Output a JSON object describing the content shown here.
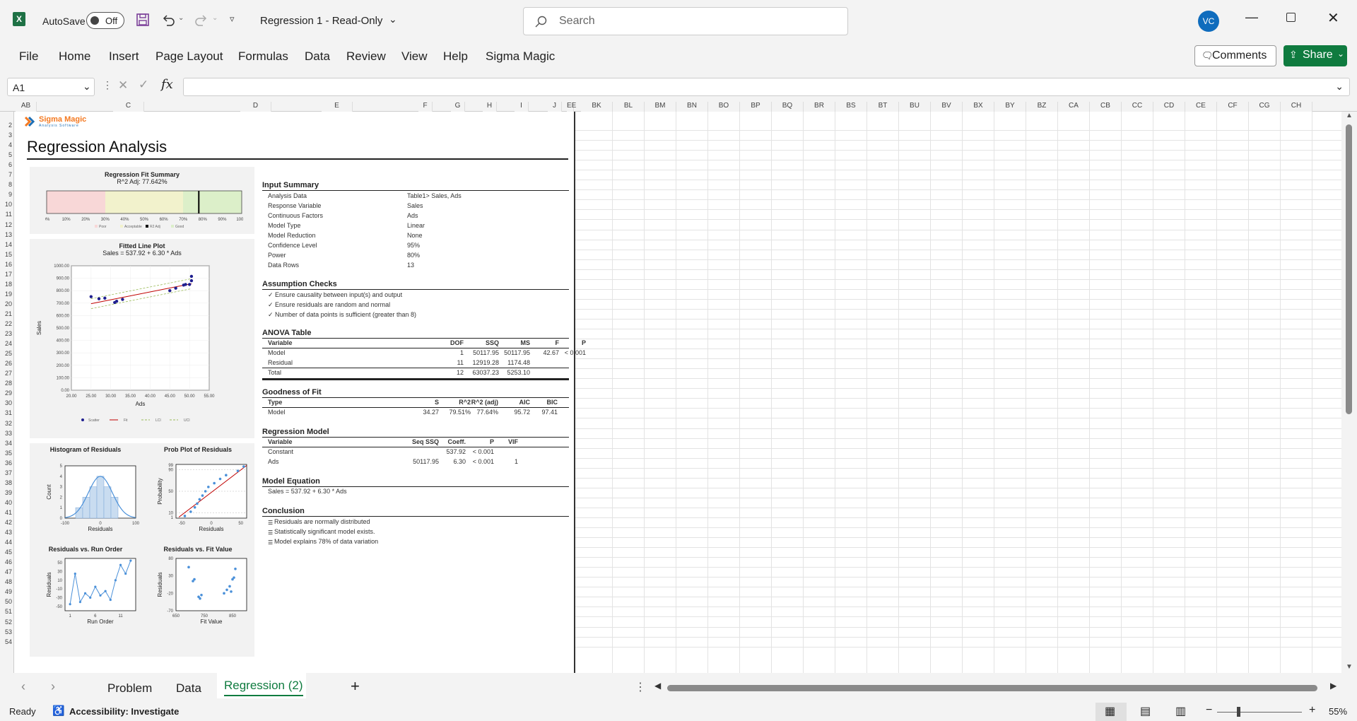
{
  "titlebar": {
    "autosave": "AutoSave",
    "toggle": "Off",
    "doc_title": "Regression 1  -  Read-Only",
    "search_placeholder": "Search",
    "avatar": "VC"
  },
  "ribbon": {
    "tabs": [
      "File",
      "Home",
      "Insert",
      "Page Layout",
      "Formulas",
      "Data",
      "Review",
      "View",
      "Help",
      "Sigma Magic"
    ],
    "comments": "Comments",
    "share": "Share"
  },
  "formula_bar": {
    "name_box": "A1",
    "fx": "fx",
    "value": ""
  },
  "columns_left": [
    "AB",
    "C",
    "D",
    "E",
    "F",
    "G",
    "H",
    "I",
    "J",
    "EE"
  ],
  "columns_right": [
    "BK",
    "BL",
    "BM",
    "BN",
    "BO",
    "BP",
    "BQ",
    "BR",
    "BS",
    "BT",
    "BU",
    "BV",
    "BX",
    "BY",
    "BZ",
    "CA",
    "CB",
    "CC",
    "CD",
    "CE",
    "CF",
    "CG",
    "CH"
  ],
  "rows": [
    "2",
    "3",
    "4",
    "5",
    "6",
    "7",
    "8",
    "9",
    "10",
    "11",
    "12",
    "13",
    "14",
    "15",
    "16",
    "17",
    "18",
    "19",
    "20",
    "21",
    "22",
    "23",
    "24",
    "25",
    "26",
    "27",
    "28",
    "29",
    "30",
    "31",
    "32",
    "33",
    "34",
    "35",
    "36",
    "37",
    "38",
    "39",
    "40",
    "41",
    "42",
    "43",
    "44",
    "45",
    "46",
    "47",
    "48",
    "49",
    "50",
    "51",
    "52",
    "53",
    "54"
  ],
  "report": {
    "logo_name": "Sigma Magic",
    "logo_sub": "Analysis Software",
    "title": "Regression Analysis",
    "fit_summary": {
      "title": "Regression Fit Summary",
      "subtitle": "R^2 Adj: 77.642%",
      "value_pct": 77.642,
      "ticks": [
        "0%",
        "10%",
        "20%",
        "30%",
        "40%",
        "50%",
        "60%",
        "70%",
        "80%",
        "90%",
        "100%"
      ],
      "legend": [
        "Poor",
        "Acceptable",
        "R2 Adj",
        "Good"
      ]
    },
    "input_summary": {
      "header": "Input Summary",
      "rows": [
        [
          "Analysis Data",
          "Table1> Sales, Ads"
        ],
        [
          "Response Variable",
          "Sales"
        ],
        [
          "Continuous Factors",
          "Ads"
        ],
        [
          "Model Type",
          "Linear"
        ],
        [
          "Model Reduction",
          "None"
        ],
        [
          "Confidence Level",
          "95%"
        ],
        [
          "Power",
          "80%"
        ],
        [
          "Data Rows",
          "13"
        ]
      ]
    },
    "assumptions": {
      "header": "Assumption Checks",
      "items": [
        "✓ Ensure causality between input(s) and output",
        "✓ Ensure residuals are random and normal",
        "✓ Number of data points is sufficient (greater than 8)"
      ]
    },
    "anova": {
      "header": "ANOVA Table",
      "cols": [
        "Variable",
        "DOF",
        "SSQ",
        "MS",
        "F",
        "P"
      ],
      "rows": [
        [
          "Model",
          "1",
          "50117.95",
          "50117.95",
          "42.67",
          "< 0.001"
        ],
        [
          "Residual",
          "11",
          "12919.28",
          "1174.48",
          "",
          ""
        ],
        [
          "Total",
          "12",
          "63037.23",
          "5253.10",
          "",
          ""
        ]
      ]
    },
    "gof": {
      "header": "Goodness of Fit",
      "cols": [
        "Type",
        "S",
        "R^2",
        "R^2 (adj)",
        "AIC",
        "BIC"
      ],
      "rows": [
        [
          "Model",
          "34.27",
          "79.51%",
          "77.64%",
          "95.72",
          "97.41"
        ]
      ]
    },
    "reg_model": {
      "header": "Regression Model",
      "cols": [
        "Variable",
        "Seq SSQ",
        "Coeff.",
        "P",
        "VIF"
      ],
      "rows": [
        [
          "Constant",
          "",
          "537.92",
          "< 0.001",
          ""
        ],
        [
          "Ads",
          "50117.95",
          "6.30",
          "< 0.001",
          "1"
        ]
      ]
    },
    "equation": {
      "header": "Model Equation",
      "text": "Sales = 537.92 + 6.30 * Ads"
    },
    "conclusion": {
      "header": "Conclusion",
      "items": [
        "Residuals are normally distributed",
        "Statistically significant model exists.",
        "Model explains 78% of data variation"
      ]
    }
  },
  "chart_data": [
    {
      "type": "scatter",
      "title": "Fitted Line Plot",
      "subtitle": "Sales = 537.92 + 6.30 * Ads",
      "xlabel": "Ads",
      "ylabel": "Sales",
      "xlim": [
        20,
        55
      ],
      "ylim": [
        0,
        1000
      ],
      "xticks": [
        "20.00",
        "25.00",
        "30.00",
        "35.00",
        "40.00",
        "45.00",
        "50.00",
        "55.00"
      ],
      "yticks": [
        "0.00",
        "100.00",
        "200.00",
        "300.00",
        "400.00",
        "500.00",
        "600.00",
        "700.00",
        "800.00",
        "900.00",
        "1000.00"
      ],
      "x": [
        25,
        27,
        28.5,
        31,
        31.5,
        33,
        45,
        46.5,
        48.5,
        49,
        50,
        50.5,
        50.5
      ],
      "y": [
        752,
        735,
        740,
        705,
        715,
        730,
        800,
        820,
        845,
        850,
        850,
        880,
        915
      ],
      "fit": {
        "intercept": 537.92,
        "slope": 6.3
      },
      "legend": [
        "Scatter",
        "Fit",
        "LCI",
        "UCI"
      ]
    },
    {
      "type": "bar",
      "title": "Histogram of Residuals",
      "xlabel": "Residuals",
      "ylabel": "Count",
      "xticks": [
        "-100",
        "0",
        "100"
      ],
      "yticks": [
        "0",
        "1",
        "2",
        "3",
        "4",
        "5"
      ],
      "categories": [
        "-60",
        "-40",
        "-20",
        "0",
        "20",
        "40"
      ],
      "values": [
        1,
        2,
        3,
        4,
        3,
        2
      ]
    },
    {
      "type": "scatter",
      "title": "Prob Plot of Residuals",
      "xlabel": "Residuals",
      "ylabel": "Probability",
      "xticks": [
        "-50",
        "0",
        "50"
      ],
      "yticks": [
        "1",
        "10",
        "50",
        "90",
        "99"
      ],
      "x": [
        -45,
        -35,
        -28,
        -24,
        -20,
        -15,
        -10,
        -5,
        5,
        15,
        25,
        45,
        55
      ],
      "y": [
        4,
        12,
        20,
        27,
        35,
        42,
        50,
        58,
        65,
        73,
        80,
        88,
        96
      ]
    },
    {
      "type": "line",
      "title": "Residuals vs. Run Order",
      "xlabel": "Run Order",
      "ylabel": "Residuals",
      "xticks": [
        "1",
        "6",
        "11"
      ],
      "yticks": [
        "-50",
        "-30",
        "-10",
        "10",
        "30",
        "50"
      ],
      "x": [
        1,
        2,
        3,
        4,
        5,
        6,
        7,
        8,
        9,
        10,
        11,
        12,
        13
      ],
      "y": [
        -45,
        25,
        -40,
        -20,
        -30,
        -5,
        -25,
        -15,
        -35,
        10,
        45,
        25,
        55
      ]
    },
    {
      "type": "scatter",
      "title": "Residuals vs. Fit Value",
      "xlabel": "Fit Value",
      "ylabel": "Residuals",
      "xticks": [
        "650",
        "750",
        "850"
      ],
      "yticks": [
        "-70",
        "-20",
        "30",
        "80"
      ],
      "x": [
        695,
        710,
        715,
        730,
        735,
        740,
        820,
        830,
        840,
        845,
        850,
        860,
        855
      ],
      "y": [
        55,
        15,
        20,
        -30,
        -35,
        -25,
        -20,
        -10,
        0,
        -15,
        20,
        50,
        25
      ]
    }
  ],
  "sheet_tabs": {
    "tabs": [
      "Problem",
      "Data",
      "Regression (2)"
    ],
    "active": "Regression (2)"
  },
  "status": {
    "ready": "Ready",
    "accessibility": "Accessibility: Investigate",
    "zoom": "55%"
  }
}
